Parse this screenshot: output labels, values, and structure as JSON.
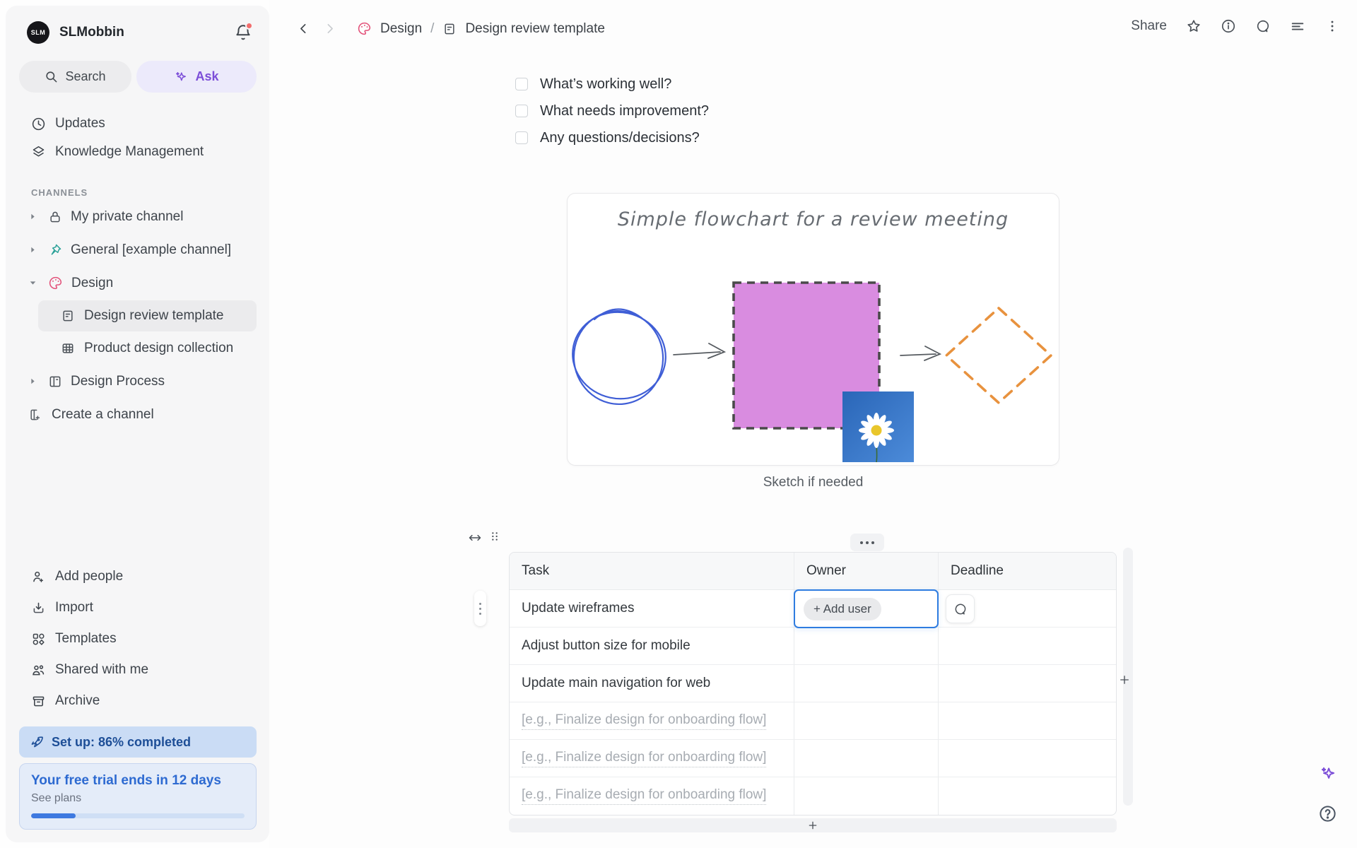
{
  "sidebar": {
    "workspace": {
      "initials": "SLM",
      "name": "SLMobbin"
    },
    "search_label": "Search",
    "ask_label": "Ask",
    "nav": [
      {
        "label": "Updates",
        "icon": "clock-icon"
      },
      {
        "label": "Knowledge Management",
        "icon": "layers-icon"
      }
    ],
    "channels_header": "CHANNELS",
    "channels": [
      {
        "label": "My private channel",
        "icon": "lock-icon"
      },
      {
        "label": "General [example channel]",
        "icon": "pin-icon"
      },
      {
        "label": "Design",
        "icon": "palette-icon"
      }
    ],
    "design_children": [
      {
        "label": "Design review template",
        "icon": "document-icon",
        "selected": true
      },
      {
        "label": "Product design collection",
        "icon": "grid-icon"
      }
    ],
    "design_process_label": "Design Process",
    "create_channel_label": "Create a channel",
    "footer_nav": [
      {
        "label": "Add people",
        "icon": "person-plus-icon"
      },
      {
        "label": "Import",
        "icon": "import-icon"
      },
      {
        "label": "Templates",
        "icon": "shapes-icon"
      },
      {
        "label": "Shared with me",
        "icon": "people-icon"
      },
      {
        "label": "Archive",
        "icon": "archive-icon"
      }
    ],
    "setup_banner": {
      "label": "Set up: 86% completed",
      "icon": "rocket-icon"
    },
    "trial": {
      "title": "Your free trial ends in 12 days",
      "link": "See plans",
      "progress_pct": 21
    }
  },
  "topbar": {
    "breadcrumb": {
      "channel": "Design",
      "separator": "/",
      "page": "Design review template"
    },
    "share_label": "Share"
  },
  "content": {
    "checklist": [
      "What’s working well?",
      "What needs improvement?",
      "Any questions/decisions?"
    ],
    "canvas": {
      "title": "Simple flowchart for a review meeting",
      "caption": "Sketch if needed",
      "shapes": [
        "hand-drawn blue circle",
        "purple dashed square",
        "orange dashed diamond",
        "daisy photo"
      ]
    },
    "table": {
      "columns": [
        "Task",
        "Owner",
        "Deadline"
      ],
      "add_user_label": "+ Add user",
      "rows": [
        {
          "task": "Update wireframes",
          "selected": true
        },
        {
          "task": "Adjust button size for mobile"
        },
        {
          "task": "Update main navigation for web"
        },
        {
          "task": "[e.g., Finalize design for onboarding flow]",
          "placeholder": true
        },
        {
          "task": "[e.g., Finalize design for onboarding flow]",
          "placeholder": true
        },
        {
          "task": "[e.g., Finalize design for onboarding flow]",
          "placeholder": true
        }
      ]
    }
  },
  "colors": {
    "accent_blue": "#2E7CE0",
    "ask_purple": "#7C4ED8",
    "pin_teal": "#2AA198",
    "palette_pink": "#E3527A",
    "square_fill": "#D98CE0",
    "diamond_orange": "#E8923E",
    "circle_blue": "#3F5ED6",
    "banner_text": "#1D4E97",
    "trial_text": "#2D6AD1",
    "notification_red": "#F26D6D"
  }
}
